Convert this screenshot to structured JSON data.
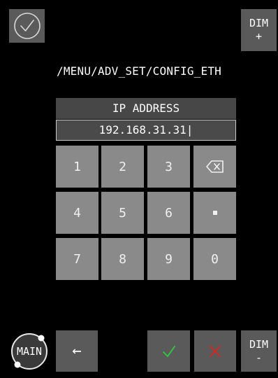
{
  "header": {
    "path": "/MENU/ADV_SET/CONFIG_ETH",
    "dim_plus": {
      "line1": "DIM",
      "line2": "+"
    },
    "dim_minus": {
      "line1": "DIM",
      "line2": "-"
    }
  },
  "panel": {
    "title": "IP ADDRESS",
    "value": "192.168.31.31|"
  },
  "keypad": {
    "keys": [
      "1",
      "2",
      "3",
      "⌫",
      "4",
      "5",
      "6",
      "▪",
      "7",
      "8",
      "9",
      "0"
    ]
  },
  "footer": {
    "main_label": "MAIN",
    "back_symbol": "←",
    "confirm_symbol": "✓",
    "cancel_symbol": "✕"
  },
  "colors": {
    "confirm": "#2ecc40",
    "cancel": "#e02020"
  }
}
